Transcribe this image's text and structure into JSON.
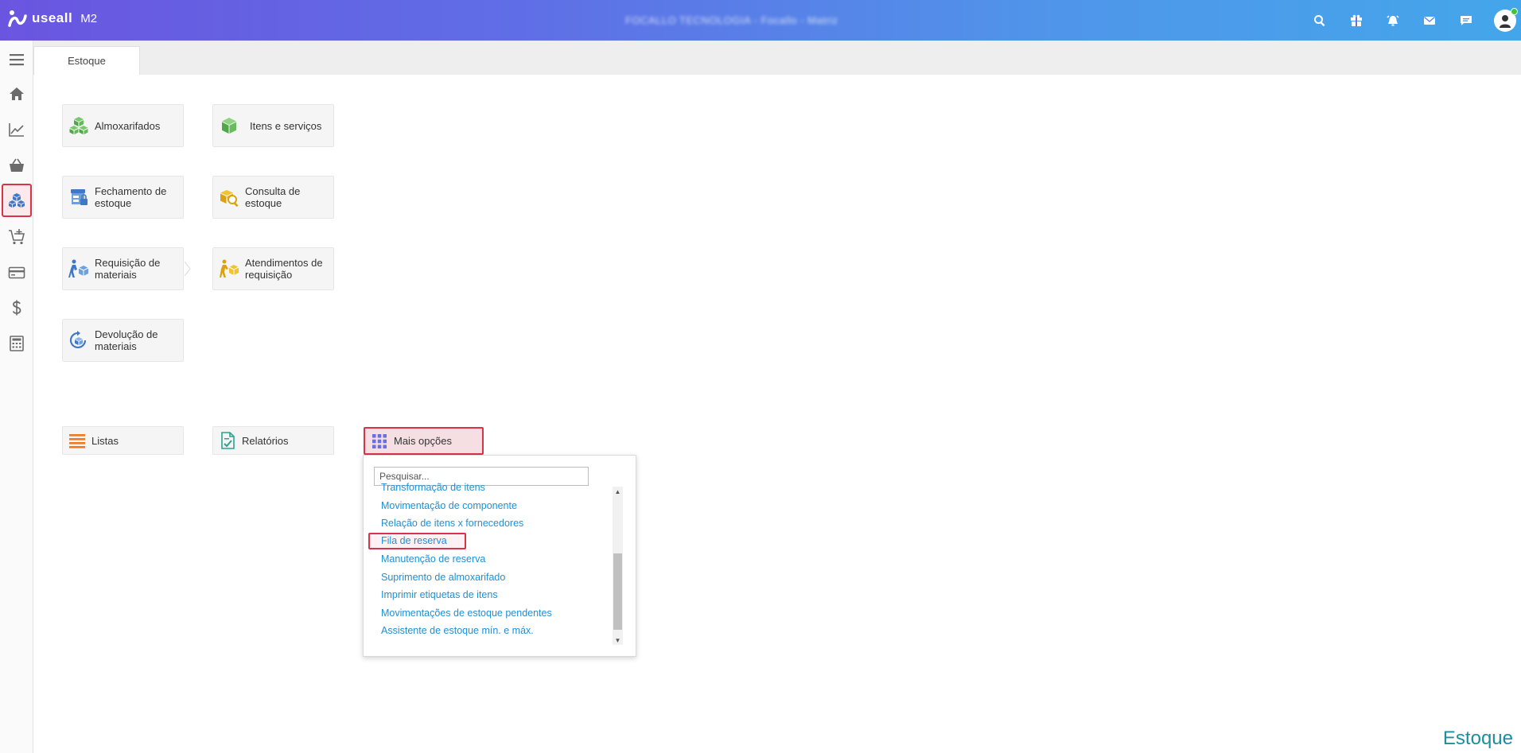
{
  "header": {
    "brand": "useall",
    "brand_sub": "M2",
    "company": "FOCALLO TECNOLOGIA - Focallo - Matriz",
    "icons": [
      "search-icon",
      "gift-icon",
      "alarm-icon",
      "mail-icon",
      "chat-icon",
      "avatar"
    ]
  },
  "sidebar": {
    "items": [
      "menu-icon",
      "home-icon",
      "chart-icon",
      "basket-icon",
      "boxes-icon",
      "cart-add-icon",
      "card-icon",
      "dollar-icon",
      "calculator-icon"
    ],
    "active": "boxes-icon"
  },
  "tabs": [
    {
      "label": "Estoque"
    }
  ],
  "tiles": {
    "almoxarifados": "Almoxarifados",
    "itens_servicos": "Itens e serviços",
    "fechamento": "Fechamento de estoque",
    "consulta": "Consulta de estoque",
    "requisicao": "Requisição de materiais",
    "atendimentos": "Atendimentos de requisição",
    "devolucao": "Devolução de materiais"
  },
  "bottom_tiles": {
    "listas": "Listas",
    "relatorios": "Relatórios",
    "mais_opcoes": "Mais opções"
  },
  "dropdown": {
    "search_placeholder": "Pesquisar...",
    "items": [
      "Transformação de itens",
      "Movimentação de componente",
      "Relação de itens x fornecedores",
      "Fila de reserva",
      "Manutenção de reserva",
      "Suprimento de almoxarifado",
      "Imprimir etiquetas de itens",
      "Movimentações de estoque pendentes",
      "Assistente de estoque mín. e máx."
    ],
    "selected": "Fila de reserva"
  },
  "module_label": "Estoque",
  "colors": {
    "accent_red": "#d9334a",
    "link_blue": "#1f8fd6",
    "module_teal": "#1a8fa0"
  }
}
